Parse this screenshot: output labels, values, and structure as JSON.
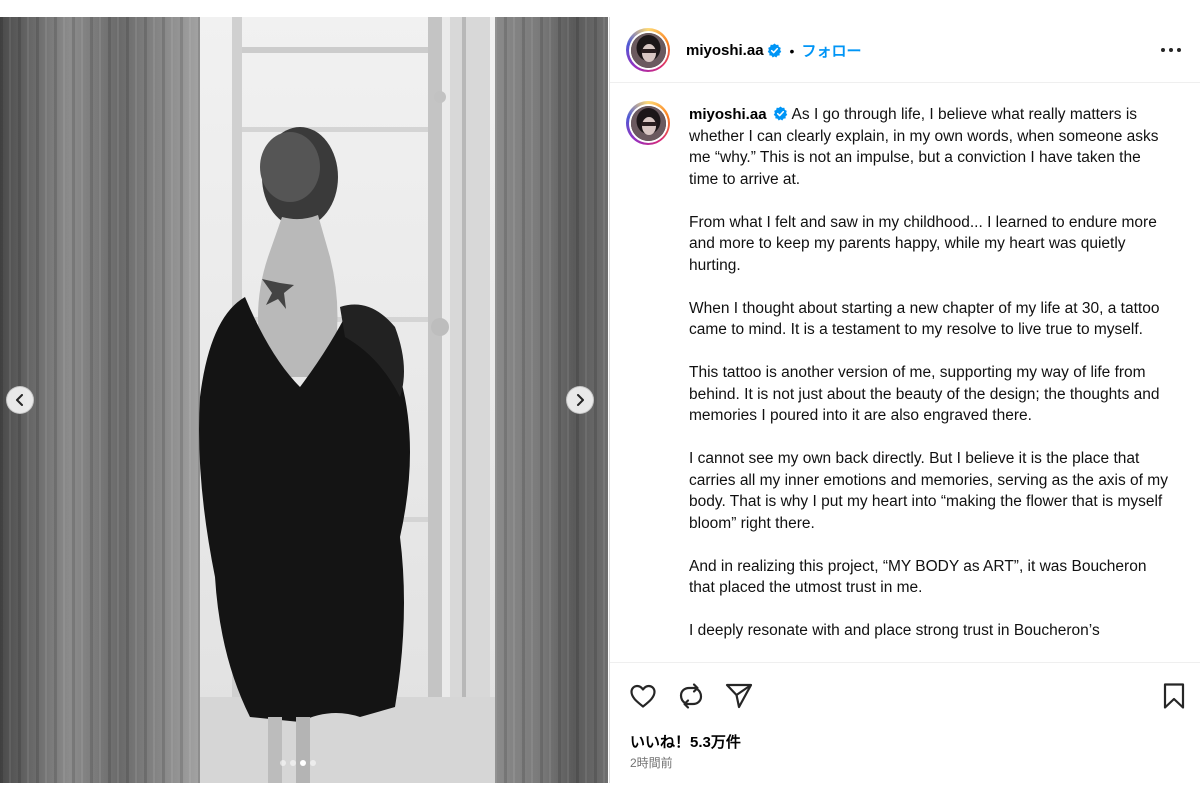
{
  "post": {
    "username": "miyoshi.aa",
    "separator": "•",
    "follow_label": "フォロー",
    "caption_paragraphs": [
      "As I go through life, I believe what really matters is whether I can clearly explain, in my own words, when someone asks me “why.”  This is not an impulse, but a conviction I have taken the time to arrive at.",
      "From what I felt and saw in my childhood... I learned to endure more and more to keep my parents happy, while my heart was quietly hurting.",
      "When I thought about starting a new chapter of my life at 30, a tattoo came to mind. It is a testament to my resolve to live true to myself.",
      "This tattoo is another version of me, supporting my way of life from behind. It is not just about the beauty of the design; the thoughts and memories I poured into it are also engraved there.",
      "I cannot see my own back directly. But I believe it is the place that carries all my inner emotions and memories, serving as the axis of my body. That is why I put my heart into “making the flower that is myself bloom” right there.",
      "And in realizing this project, “MY BODY as ART”, it was Boucheron that placed the utmost trust in me.",
      "I deeply resonate with and place strong trust in Boucheron’s"
    ],
    "likes_text": "いいね！5.3万件",
    "time_text": "2時間前"
  },
  "carousel": {
    "slide_count": 4,
    "active_index": 2
  },
  "colors": {
    "accent": "#0095f6",
    "verified": "#0095f6",
    "muted": "#737373"
  },
  "icons": {
    "left_arrow": "chevron-left-icon",
    "right_arrow": "chevron-right-icon",
    "more": "more-horizontal-icon",
    "like": "heart-icon",
    "repost": "repost-icon",
    "share": "send-icon",
    "save": "bookmark-icon"
  }
}
